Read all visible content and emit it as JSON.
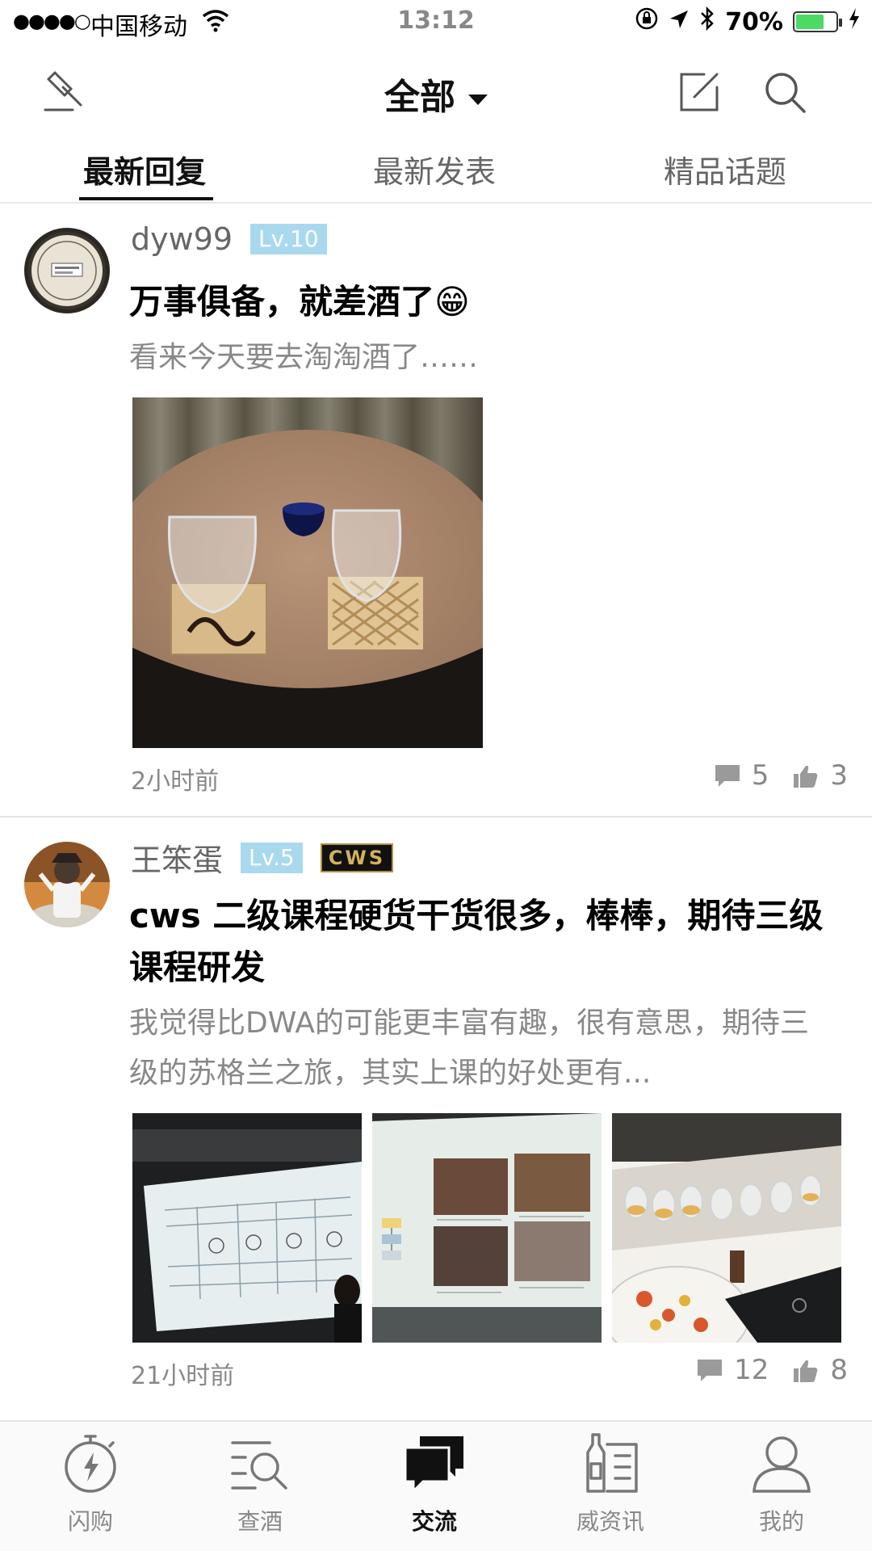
{
  "status_bar": {
    "signal": "●●●●○",
    "carrier": "中国移动",
    "time": "13:12",
    "battery": "70%",
    "battery_level": 0.7
  },
  "header": {
    "title": "全部",
    "icons": [
      "hammer-icon",
      "compose-icon",
      "search-icon"
    ]
  },
  "tabs": [
    {
      "label": "最新回复",
      "active": true
    },
    {
      "label": "最新发表",
      "active": false
    },
    {
      "label": "精品话题",
      "active": false
    }
  ],
  "posts": [
    {
      "author": "dyw99",
      "level": "Lv.10",
      "title": "万事俱备，就差酒了😁",
      "excerpt": "看来今天要去淘淘酒了……",
      "time": "2小时前",
      "comments": "5",
      "likes": "3"
    },
    {
      "author": "王笨蛋",
      "level": "Lv.5",
      "badge": "CWS",
      "title": "cws 二级课程硬货干货很多，棒棒，期待三级课程研发",
      "excerpt": "我觉得比DWA的可能更丰富有趣，很有意思，期待三级的苏格兰之旅，其实上课的好处更有...",
      "time": "21小时前",
      "comments": "12",
      "likes": "8"
    }
  ],
  "bottom_nav": [
    {
      "label": "闪购",
      "icon": "stopwatch-bolt-icon",
      "active": false
    },
    {
      "label": "查酒",
      "icon": "list-search-icon",
      "active": false
    },
    {
      "label": "交流",
      "icon": "chat-bubbles-icon",
      "active": true
    },
    {
      "label": "威资讯",
      "icon": "bottle-news-icon",
      "active": false
    },
    {
      "label": "我的",
      "icon": "person-icon",
      "active": false
    }
  ],
  "colors": {
    "level_badge": "#a9d9ee",
    "text_primary": "#111111",
    "text_secondary": "#888888",
    "battery": "#4cd964"
  }
}
